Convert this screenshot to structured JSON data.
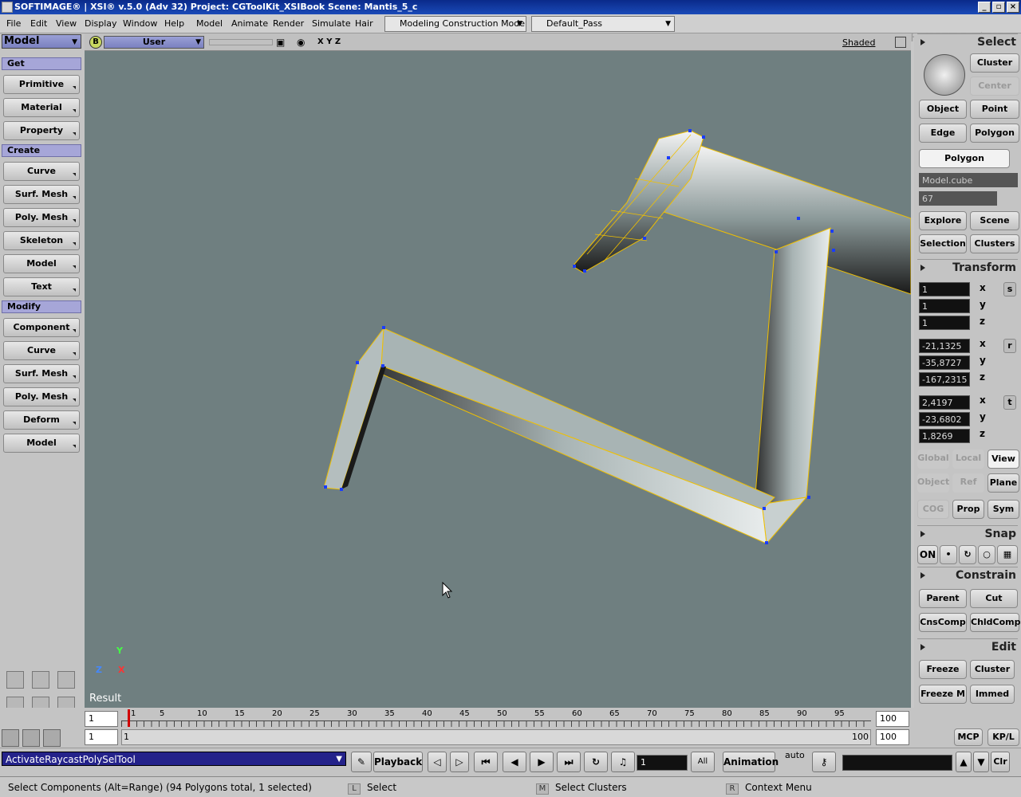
{
  "title": "SOFTIMAGE® | XSI® v.5.0 (Adv 32) Project: CGToolKit_XSIBook    Scene: Mantis_5_c",
  "brand": "SOFTIMAGE | XSI",
  "menu": [
    "File",
    "Edit",
    "View",
    "Display",
    "Window",
    "Help",
    "Model",
    "Animate",
    "Render",
    "Simulate",
    "Hair"
  ],
  "mode_dropdown": "Modeling Construction Mode",
  "pass_dropdown": "Default_Pass",
  "left": {
    "mode": "Model",
    "get": "Get",
    "get_items": [
      "Primitive",
      "Material",
      "Property"
    ],
    "create": "Create",
    "create_items": [
      "Curve",
      "Surf. Mesh",
      "Poly. Mesh",
      "Skeleton",
      "Model",
      "Text"
    ],
    "modify": "Modify",
    "modify_items": [
      "Component",
      "Curve",
      "Surf. Mesh",
      "Poly. Mesh",
      "Deform",
      "Model"
    ]
  },
  "viewport": {
    "b_badge": "B",
    "camera": "User",
    "axes": "X Y Z",
    "shading": "Shaded",
    "result": "Result",
    "gizmo_y": "Y",
    "gizmo_z": "Z",
    "gizmo_x": "X"
  },
  "right": {
    "select": "Select",
    "cluster": "Cluster",
    "center": "Center",
    "object": "Object",
    "point": "Point",
    "edge": "Edge",
    "polygon": "Polygon",
    "polygon_mode": "Polygon",
    "model_field": "Model.cube",
    "count_field": "67",
    "explore": "Explore",
    "scene": "Scene",
    "selection": "Selection",
    "clusters": "Clusters",
    "transform": "Transform",
    "scale": [
      "1",
      "1",
      "1"
    ],
    "rotate": [
      "-21,1325",
      "-35,8727",
      "-167,2315"
    ],
    "translate": [
      "2,4197",
      "-23,6802",
      "1,8269"
    ],
    "axis_labels": [
      "x",
      "y",
      "z"
    ],
    "tr_s": "s",
    "tr_r": "r",
    "tr_t": "t",
    "global": "Global",
    "local": "Local",
    "view": "View",
    "object_ref": "Object",
    "ref": "Ref",
    "plane": "Plane",
    "cog": "COG",
    "prop": "Prop",
    "sym": "Sym",
    "snap": "Snap",
    "on": "ON",
    "constrain": "Constrain",
    "parent": "Parent",
    "cut": "Cut",
    "cnscomp": "CnsComp",
    "chldcomp": "ChldComp",
    "edit": "Edit",
    "freeze": "Freeze",
    "edit_cluster": "Cluster",
    "freeze_m": "Freeze M",
    "immed": "Immed",
    "mcp": "MCP",
    "kpl": "KP/L"
  },
  "timeline": {
    "start": "1",
    "end": "100",
    "range_start": "1",
    "range_start2": "1",
    "range_end": "100",
    "range_end2": "100",
    "ticks": [
      "1",
      "5",
      "10",
      "15",
      "20",
      "25",
      "30",
      "35",
      "40",
      "45",
      "50",
      "55",
      "60",
      "65",
      "70",
      "75",
      "80",
      "85",
      "90",
      "95"
    ]
  },
  "playbar": {
    "command": "ActivateRaycastPolySelTool",
    "playback": "Playback",
    "frame": "1",
    "all": "All",
    "animation": "Animation",
    "auto": "auto",
    "clr": "Clr"
  },
  "status": {
    "message": "Select Components (Alt=Range) (94 Polygons total, 1 selected)",
    "l_key": "L",
    "l_action": "Select",
    "m_key": "M",
    "m_action": "Select Clusters",
    "r_key": "R",
    "r_action": "Context Menu"
  }
}
